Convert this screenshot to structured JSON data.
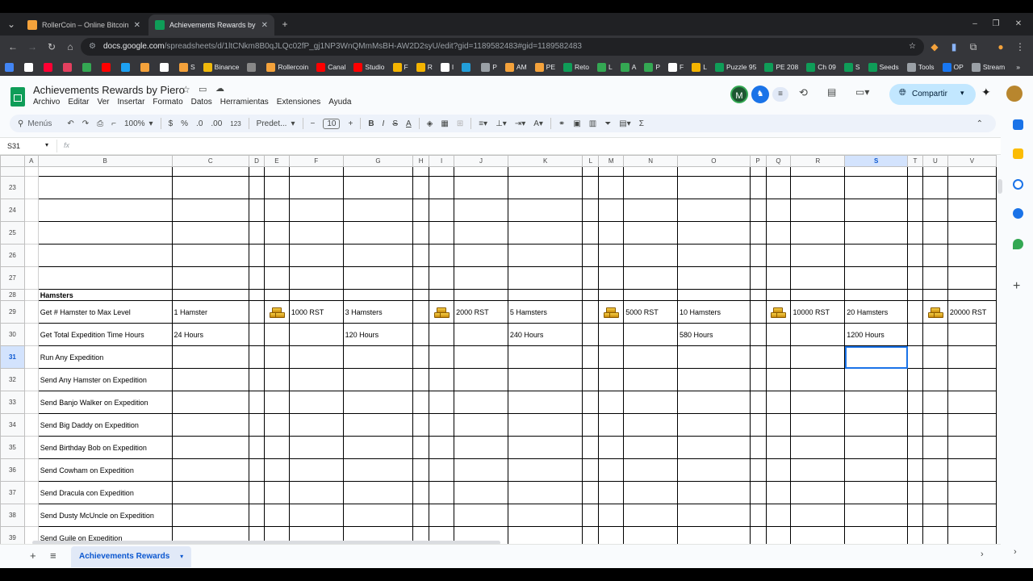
{
  "browser": {
    "tabs": [
      {
        "title": "RollerCoin – Online Bitcoin Mi…",
        "active": false,
        "favicon_color": "#f4a23b"
      },
      {
        "title": "Achievements Rewards by Piero",
        "active": true,
        "favicon_color": "#0f9d58"
      }
    ],
    "new_tab": "+",
    "url_host": "docs.google.com",
    "url_path": "/spreadsheets/d/1ltCNkm8B0qJLQc02fP_gj1NP3WnQMmMsBH-AW2D2syU/edit?gid=1189582483#gid=1189582483",
    "bookmarks": [
      {
        "label": "",
        "color": "#4285f4"
      },
      {
        "label": "",
        "color": "#ffffff"
      },
      {
        "label": "",
        "color": "#ff0033"
      },
      {
        "label": "",
        "color": "#e4405f"
      },
      {
        "label": "",
        "color": "#34a853"
      },
      {
        "label": "",
        "color": "#ff0000"
      },
      {
        "label": "",
        "color": "#1da1f2"
      },
      {
        "label": "",
        "color": "#f4a23b"
      },
      {
        "label": "",
        "color": "#ffffff"
      },
      {
        "label": "S",
        "color": "#f4a23b"
      },
      {
        "label": "Binance",
        "color": "#f0b90b"
      },
      {
        "label": "",
        "color": "#888888"
      },
      {
        "label": "Rollercoin",
        "color": "#f4a23b"
      },
      {
        "label": "Canal",
        "color": "#ff0000"
      },
      {
        "label": "Studio",
        "color": "#ff0000"
      },
      {
        "label": "F",
        "color": "#f4b400"
      },
      {
        "label": "R",
        "color": "#f4b400"
      },
      {
        "label": "I",
        "color": "#ffffff"
      },
      {
        "label": "",
        "color": "#229ed9"
      },
      {
        "label": "P",
        "color": "#9aa0a6"
      },
      {
        "label": "AM",
        "color": "#f4a23b"
      },
      {
        "label": "PE",
        "color": "#f4a23b"
      },
      {
        "label": "Reto",
        "color": "#0f9d58"
      },
      {
        "label": "L",
        "color": "#34a853"
      },
      {
        "label": "A",
        "color": "#34a853"
      },
      {
        "label": "P",
        "color": "#34a853"
      },
      {
        "label": "F",
        "color": "#ffffff"
      },
      {
        "label": "L",
        "color": "#f4b400"
      },
      {
        "label": "Puzzle 95",
        "color": "#0f9d58"
      },
      {
        "label": "PE 208",
        "color": "#0f9d58"
      },
      {
        "label": "Ch 09",
        "color": "#0f9d58"
      },
      {
        "label": "S",
        "color": "#0f9d58"
      },
      {
        "label": "Seeds",
        "color": "#0f9d58"
      },
      {
        "label": "Tools",
        "color": "#9aa0a6"
      },
      {
        "label": "OP",
        "color": "#1877f2"
      },
      {
        "label": "Stream",
        "color": "#9aa0a6"
      }
    ]
  },
  "sheet": {
    "title": "Achievements Rewards by Piero",
    "menus": [
      "Archivo",
      "Editar",
      "Ver",
      "Insertar",
      "Formato",
      "Datos",
      "Herramientas",
      "Extensiones",
      "Ayuda"
    ],
    "avatar_letter": "M",
    "share_label": "Compartir",
    "toolbar": {
      "search": "Menús",
      "zoom": "100%",
      "currency": "$",
      "percent": "%",
      "dec_less": ".0",
      "dec_more": ".00",
      "number_format": "123",
      "font": "Predet...",
      "font_size": "10",
      "bold": "B",
      "italic": "I",
      "strike": "S",
      "text_color": "A",
      "function": "Σ"
    },
    "name_box": "S31",
    "fx": "fx",
    "columns": [
      "A",
      "B",
      "C",
      "D",
      "E",
      "F",
      "G",
      "H",
      "I",
      "J",
      "K",
      "L",
      "M",
      "N",
      "O",
      "P",
      "Q",
      "R",
      "S",
      "T",
      "U",
      "V"
    ],
    "selected_column": "S",
    "selected_row": "31",
    "rows": [
      {
        "num": "",
        "B": ""
      },
      {
        "num": "23",
        "B": ""
      },
      {
        "num": "24",
        "B": ""
      },
      {
        "num": "25",
        "B": ""
      },
      {
        "num": "26",
        "B": ""
      },
      {
        "num": "27",
        "B": ""
      },
      {
        "num": "28",
        "B": "Hamsters",
        "bold": true
      },
      {
        "num": "29",
        "B": "Get # Hamster to Max Level",
        "C": "1 Hamster",
        "F": "1000 RST",
        "G": "3 Hamsters",
        "J": "2000 RST",
        "K": "5 Hamsters",
        "N": "5000 RST",
        "O": "10 Hamsters",
        "R": "10000 RST",
        "S": "20 Hamsters",
        "V": "20000 RST",
        "icons": [
          "E",
          "I",
          "M",
          "Q",
          "U"
        ]
      },
      {
        "num": "30",
        "B": "Get Total Expedition Time Hours",
        "C": "24 Hours",
        "G": "120 Hours",
        "K": "240 Hours",
        "O": "580 Hours",
        "S": "1200 Hours"
      },
      {
        "num": "31",
        "B": "Run Any Expedition"
      },
      {
        "num": "32",
        "B": "Send Any Hamster on Expedition"
      },
      {
        "num": "33",
        "B": "Send Banjo Walker on Expedition"
      },
      {
        "num": "34",
        "B": "Send Big Daddy on Expedition"
      },
      {
        "num": "35",
        "B": "Send Birthday Bob on Expedition"
      },
      {
        "num": "36",
        "B": "Send Cowham on Expedition"
      },
      {
        "num": "37",
        "B": "Send Dracula con Expedition"
      },
      {
        "num": "38",
        "B": "Send Dusty McUncle on Expedition"
      },
      {
        "num": "39",
        "B": "Send Guile on Expedition"
      }
    ],
    "sheet_tab": "Achievements Rewards",
    "add_sheet": "+",
    "sheets_list": "≡"
  }
}
